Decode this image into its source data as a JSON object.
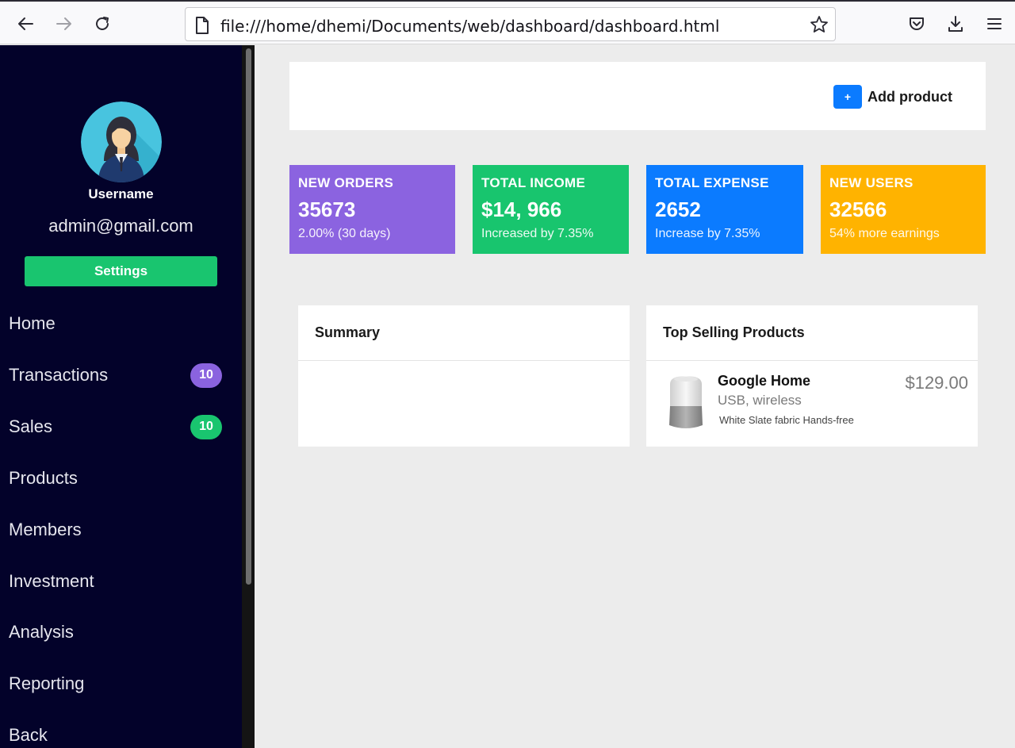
{
  "browser": {
    "url": "file:///home/dhemi/Documents/web/dashboard/dashboard.html"
  },
  "sidebar": {
    "username": "Username",
    "email": "admin@gmail.com",
    "settings_label": "Settings",
    "items": [
      {
        "label": "Home"
      },
      {
        "label": "Transactions",
        "badge": "10",
        "badge_color": "#8a63df"
      },
      {
        "label": "Sales",
        "badge": "10",
        "badge_color": "#19c56f"
      },
      {
        "label": "Products"
      },
      {
        "label": "Members"
      },
      {
        "label": "Investment"
      },
      {
        "label": "Analysis"
      },
      {
        "label": "Reporting"
      },
      {
        "label": "Back"
      }
    ]
  },
  "header": {
    "add_product_icon": "+",
    "add_product_label": "Add product"
  },
  "stats": [
    {
      "title": "NEW ORDERS",
      "value": "35673",
      "sub": "2.00% (30 days)",
      "color": "#8b63e0"
    },
    {
      "title": "TOTAL INCOME",
      "value": "$14, 966",
      "sub": "Increased by 7.35%",
      "color": "#18c56e"
    },
    {
      "title": "TOTAL EXPENSE",
      "value": "2652",
      "sub": "Increase by 7.35%",
      "color": "#0b7bff"
    },
    {
      "title": "NEW USERS",
      "value": "32566",
      "sub": "54% more earnings",
      "color": "#ffb300"
    }
  ],
  "panels": {
    "summary_title": "Summary",
    "top_selling_title": "Top Selling Products",
    "product": {
      "name": "Google Home",
      "subtitle": "USB, wireless",
      "meta": "White Slate fabric Hands-free",
      "price": "$129.00"
    }
  }
}
